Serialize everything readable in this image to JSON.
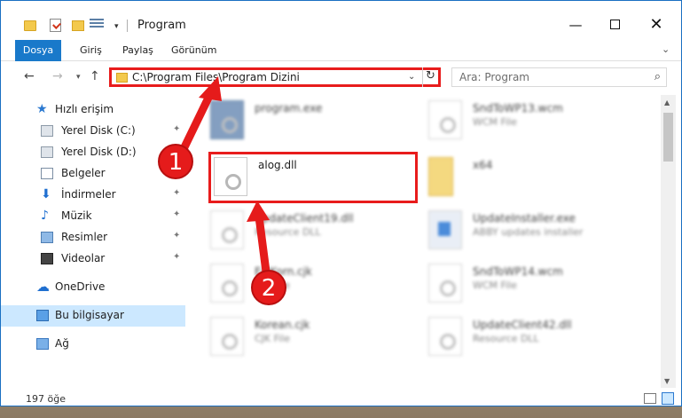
{
  "window": {
    "title": "Program",
    "minimize_glyph": "—",
    "close_glyph": "✕"
  },
  "ribbon": {
    "tabs": [
      "Dosya",
      "Giriş",
      "Paylaş",
      "Görünüm"
    ],
    "expand_glyph": "⌄"
  },
  "nav": {
    "back_glyph": "←",
    "forward_glyph": "→",
    "recent_glyph": "▾",
    "up_glyph": "↑",
    "address": "C:\\Program Files\\Program Dizini",
    "address_dropdown_glyph": "⌄",
    "refresh_glyph": "↻",
    "search_placeholder": "Ara: Program",
    "search_glyph": "⌕"
  },
  "sidebar": {
    "items": [
      {
        "label": "Hızlı erişim",
        "icon": "star-icon",
        "pinned": false
      },
      {
        "label": "Yerel Disk (C:)",
        "icon": "drive-icon",
        "pinned": true
      },
      {
        "label": "Yerel Disk (D:)",
        "icon": "drive-icon",
        "pinned": true
      },
      {
        "label": "Belgeler",
        "icon": "documents-icon",
        "pinned": true
      },
      {
        "label": "İndirmeler",
        "icon": "download-icon",
        "pinned": true
      },
      {
        "label": "Müzik",
        "icon": "music-icon",
        "pinned": true
      },
      {
        "label": "Resimler",
        "icon": "pictures-icon",
        "pinned": true
      },
      {
        "label": "Videolar",
        "icon": "videos-icon",
        "pinned": true
      },
      {
        "label": "OneDrive",
        "icon": "cloud-icon",
        "pinned": false
      },
      {
        "label": "Bu bilgisayar",
        "icon": "computer-icon",
        "pinned": false
      },
      {
        "label": "Ağ",
        "icon": "network-icon",
        "pinned": false
      }
    ],
    "pin_glyph": "✦"
  },
  "files": [
    {
      "name": "program.exe",
      "type": "",
      "icon": "exe-icon"
    },
    {
      "name": "SndToWP13.wcm",
      "type": "WCM File",
      "icon": "file-icon"
    },
    {
      "name": "alog.dll",
      "type": "",
      "icon": "dll-icon"
    },
    {
      "name": "x64",
      "type": "",
      "icon": "folder-icon"
    },
    {
      "name": "UpdateClient19.dll",
      "type": "Resource DLL",
      "icon": "dll-icon"
    },
    {
      "name": "UpdateInstaller.exe",
      "type": "ABBY updates installer",
      "icon": "installer-icon"
    },
    {
      "name": "ErrKorn.cjk",
      "type": "CJK File",
      "icon": "file-icon"
    },
    {
      "name": "SndToWP14.wcm",
      "type": "WCM File",
      "icon": "file-icon"
    },
    {
      "name": "Korean.cjk",
      "type": "CJK File",
      "icon": "file-icon"
    },
    {
      "name": "UpdateClient42.dll",
      "type": "Resource DLL",
      "icon": "dll-icon"
    }
  ],
  "callouts": [
    "1",
    "2"
  ],
  "status": {
    "item_count": "197 öğe"
  },
  "scrollbar": {
    "up_glyph": "▲",
    "down_glyph": "▼"
  },
  "colors": {
    "accent": "#1979ca",
    "highlight_red": "#e81c1c",
    "selection": "#cce8ff"
  }
}
